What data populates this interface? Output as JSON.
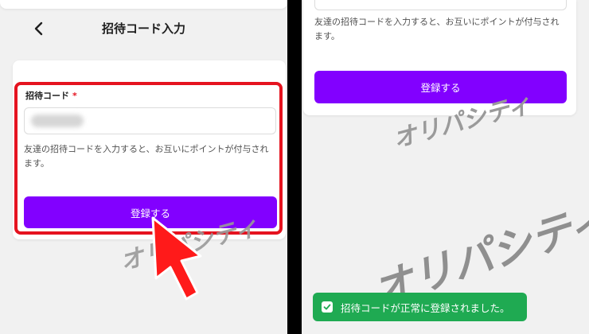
{
  "left": {
    "header": {
      "title": "招待コード入力"
    },
    "form": {
      "label": "招待コード",
      "required_mark": "*",
      "help": "友達の招待コードを入力すると、お互いにポイントが付与されます。",
      "submit_label": "登録する"
    },
    "watermark": "オリパシティ",
    "highlight_color": "#e5131f",
    "arrow_color": "#ff1a1a"
  },
  "right": {
    "help": "友達の招待コードを入力すると、お互いにポイントが付与されます。",
    "submit_label": "登録する",
    "watermark_top": "オリパシティ",
    "watermark_main": "オリパシティ",
    "toast": {
      "icon": "check-icon",
      "message": "招待コードが正常に登録されました。"
    }
  },
  "colors": {
    "primary": "#8200ff",
    "success": "#1faa52",
    "danger": "#e5131f"
  }
}
